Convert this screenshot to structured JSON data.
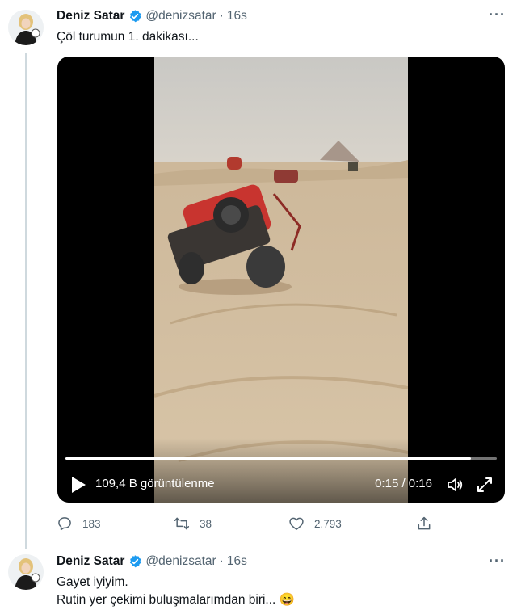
{
  "tweet1": {
    "name": "Deniz Satar",
    "handle": "@denizsatar",
    "dot": "·",
    "time": "16s",
    "more": "···",
    "text": "Çöl turumun 1. dakikası...",
    "video": {
      "views": "109,4 B görüntülenme",
      "timecode": "0:15 / 0:16",
      "progress_fraction": 0.94
    },
    "actions": {
      "replies": "183",
      "retweets": "38",
      "likes": "2.793"
    }
  },
  "tweet2": {
    "name": "Deniz Satar",
    "handle": "@denizsatar",
    "dot": "·",
    "time": "16s",
    "more": "···",
    "text_line1": "Gayet iyiyim.",
    "text_line2": "Rutin yer çekimi buluşmalarımdan biri...",
    "emoji": "😄"
  },
  "colors": {
    "verified": "#1d9bf0",
    "secondary_text": "#536471",
    "thread_line": "#cfd9de"
  },
  "icons": [
    "verified-badge-icon",
    "more-icon",
    "play-icon",
    "volume-icon",
    "fullscreen-icon",
    "reply-icon",
    "retweet-icon",
    "like-icon",
    "share-icon"
  ]
}
